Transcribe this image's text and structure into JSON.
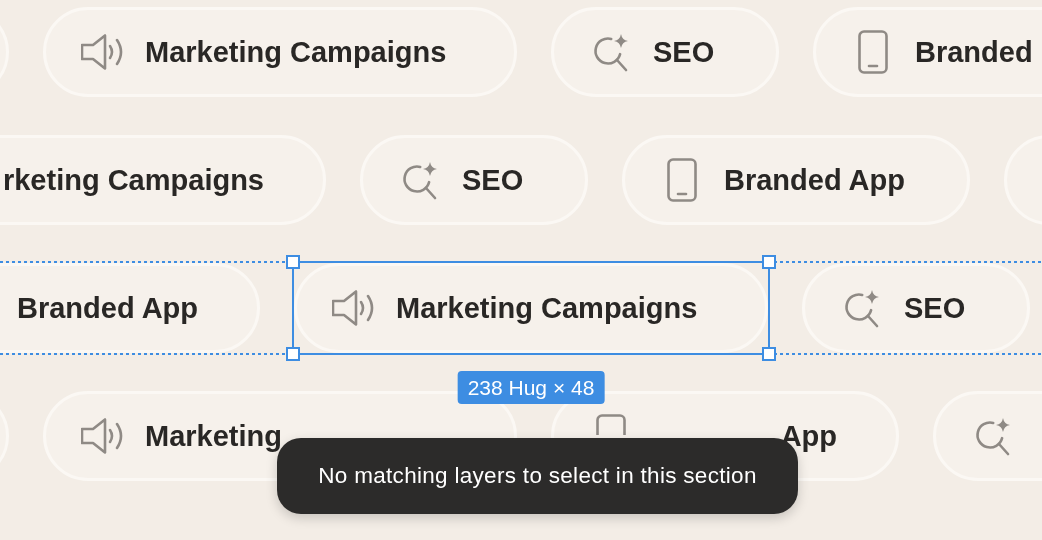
{
  "canvas": {
    "rows": [
      {
        "chips": [
          {
            "kind": "edge",
            "selected": false
          },
          {
            "kind": "speaker",
            "label": "Marketing Campaigns",
            "selected": false
          },
          {
            "kind": "search",
            "label": "SEO",
            "selected": false
          },
          {
            "kind": "phone",
            "label": "Branded",
            "selected": false
          }
        ]
      },
      {
        "chips": [
          {
            "kind": "clipped",
            "label": "rketing Campaigns",
            "selected": false
          },
          {
            "kind": "search",
            "label": "SEO",
            "selected": false
          },
          {
            "kind": "phone",
            "label": "Branded App",
            "selected": false
          },
          {
            "kind": "edge",
            "selected": false
          }
        ]
      },
      {
        "chips": [
          {
            "kind": "clipped",
            "label": "Branded App",
            "selected": false
          },
          {
            "kind": "speaker",
            "label": "Marketing Campaigns",
            "selected": true
          },
          {
            "kind": "search",
            "label": "SEO",
            "selected": false
          }
        ]
      },
      {
        "chips": [
          {
            "kind": "edge",
            "selected": false
          },
          {
            "kind": "speaker",
            "label": "Marketing",
            "selected": false
          },
          {
            "kind": "phone",
            "label": "App",
            "selected": false
          },
          {
            "kind": "search",
            "selected": false
          }
        ]
      }
    ]
  },
  "selection": {
    "size_label": "238 Hug × 48"
  },
  "toast": {
    "message": "No matching layers to select in this section"
  }
}
